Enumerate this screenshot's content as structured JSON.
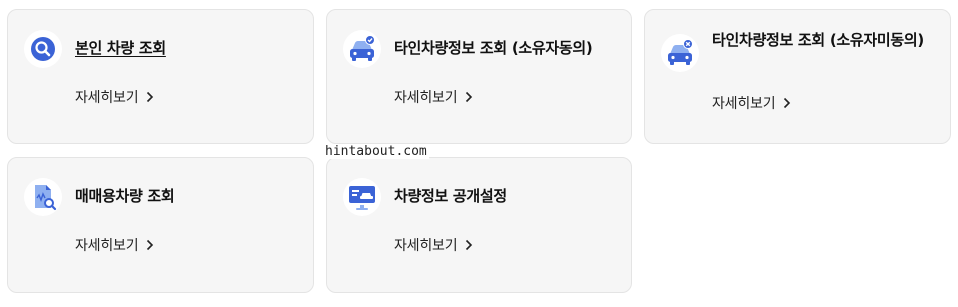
{
  "cards": [
    {
      "title": "본인 차량 조회",
      "link": "자세히보기",
      "icon": "car-search-icon"
    },
    {
      "title": "타인차량정보 조회 (소유자동의)",
      "link": "자세히보기",
      "icon": "car-check-icon"
    },
    {
      "title": "타인차량정보 조회 (소유자미동의)",
      "link": "자세히보기",
      "icon": "car-x-icon"
    },
    {
      "title": "매매용차량 조회",
      "link": "자세히보기",
      "icon": "document-search-icon"
    },
    {
      "title": "차량정보 공개설정",
      "link": "자세히보기",
      "icon": "monitor-car-icon"
    }
  ],
  "watermark": "hintabout.com",
  "colors": {
    "accent": "#3b63d6",
    "accent_light": "#8fb0f0"
  }
}
